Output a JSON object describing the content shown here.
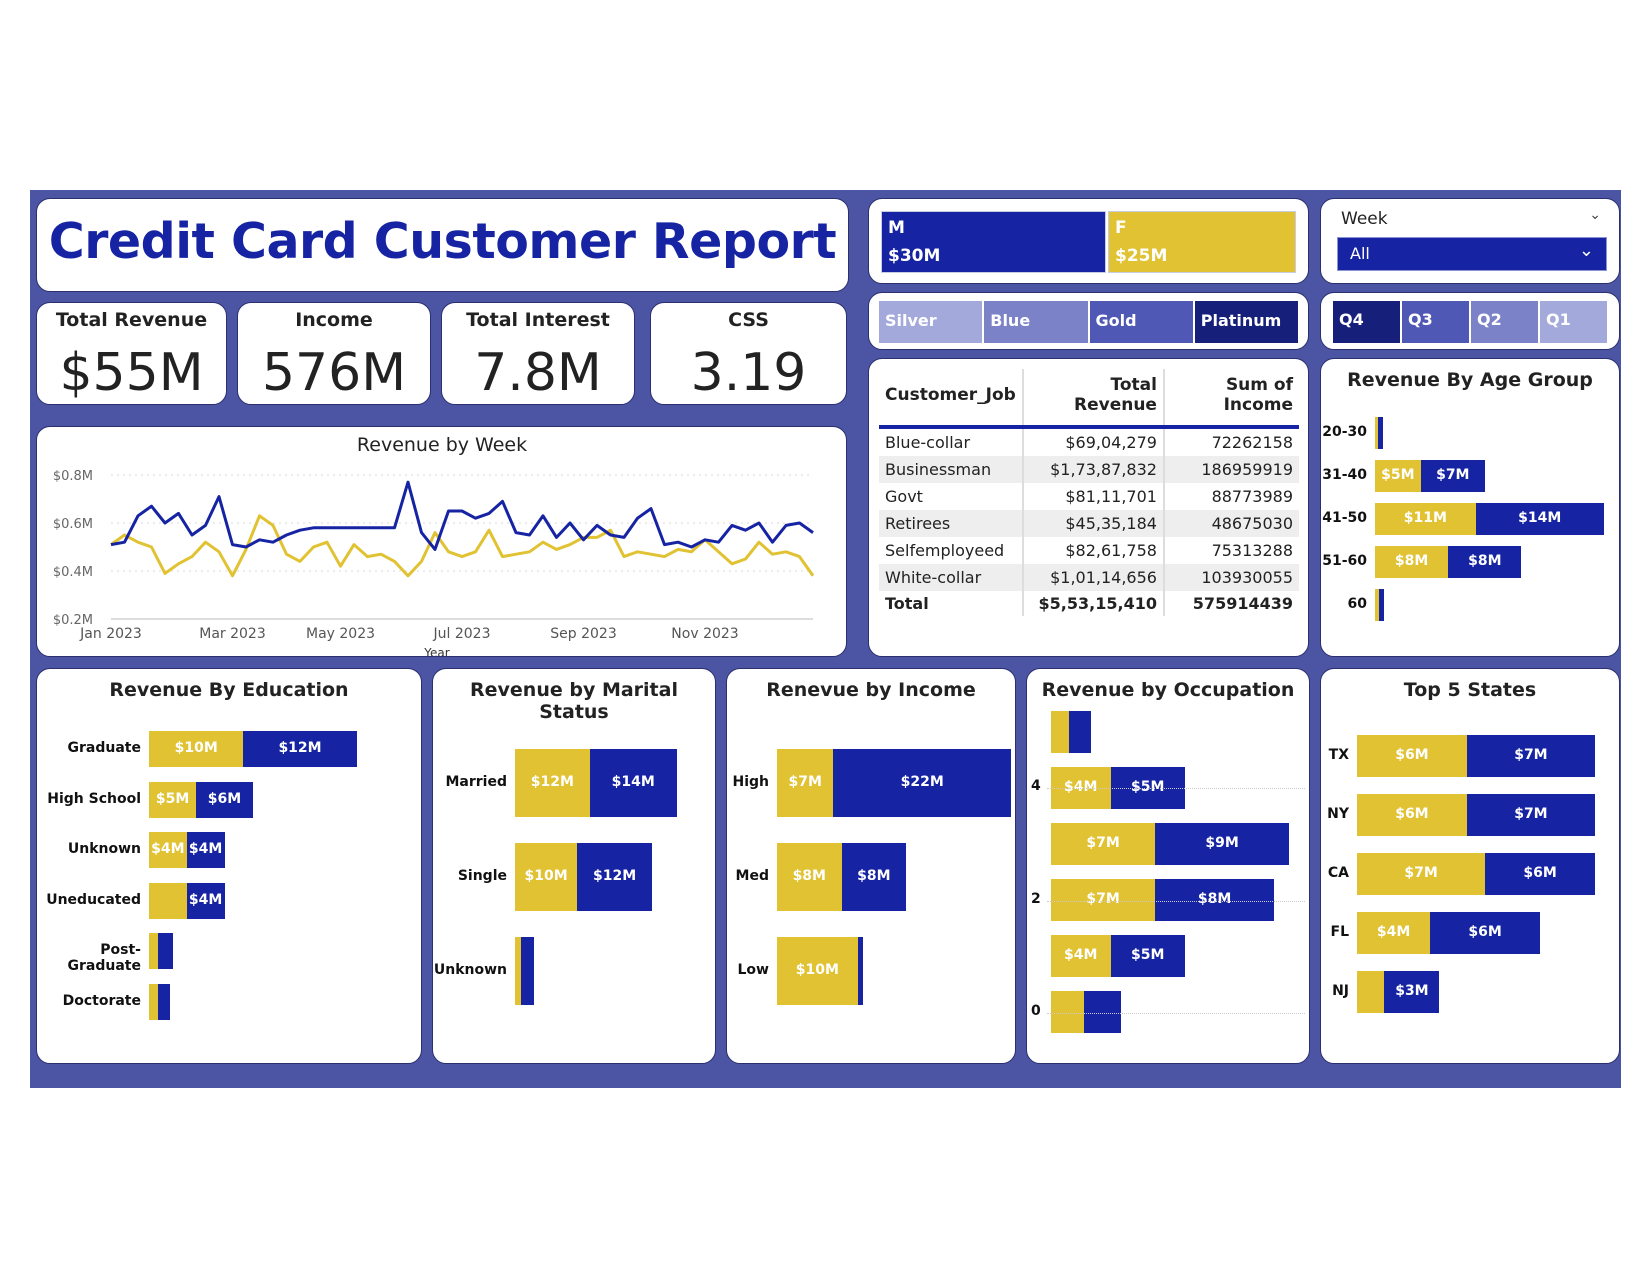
{
  "title": "Credit Card Customer Report",
  "colors": {
    "navy": "#1624a3",
    "gold": "#e0c232",
    "frame": "#4b55a3"
  },
  "kpis": [
    {
      "label": "Total Revenue",
      "value": "$55M"
    },
    {
      "label": "Income",
      "value": "576M"
    },
    {
      "label": "Total Interest",
      "value": "7.8M"
    },
    {
      "label": "CSS",
      "value": "3.19"
    }
  ],
  "gender": [
    {
      "label": "M",
      "value": "$30M",
      "share": 0.545
    },
    {
      "label": "F",
      "value": "$25M",
      "share": 0.455
    }
  ],
  "card_category": [
    "Silver",
    "Blue",
    "Gold",
    "Platinum"
  ],
  "week_slicer": {
    "label": "Week",
    "selected": "All"
  },
  "quarters": [
    "Q4",
    "Q3",
    "Q2",
    "Q1"
  ],
  "job_table": {
    "headers": [
      "Customer_Job",
      "Total Revenue",
      "Sum of Income"
    ],
    "rows": [
      [
        "Blue-collar",
        "$69,04,279",
        "72262158"
      ],
      [
        "Businessman",
        "$1,73,87,832",
        "186959919"
      ],
      [
        "Govt",
        "$81,11,701",
        "88773989"
      ],
      [
        "Retirees",
        "$45,35,184",
        "48675030"
      ],
      [
        "Selfemployeed",
        "$82,61,758",
        "75313288"
      ],
      [
        "White-collar",
        "$1,01,14,656",
        "103930055"
      ]
    ],
    "total": [
      "Total",
      "$5,53,15,410",
      "575914439"
    ]
  },
  "panels": {
    "week": "Revenue by Week",
    "age": "Revenue By Age Group",
    "education": "Revenue By Education",
    "marital": "Revenue by Marital Status",
    "income": "Renevue by Income",
    "occupation": "Revenue by Occupation",
    "states": "Top 5 States"
  },
  "chart_data": [
    {
      "type": "line",
      "title": "Revenue by Week",
      "xlabel": "Year",
      "ylabel": "",
      "x_ticks": [
        "Jan 2023",
        "Mar 2023",
        "May 2023",
        "Jul 2023",
        "Sep 2023",
        "Nov 2023"
      ],
      "y_ticks": [
        "$0.2M",
        "$0.4M",
        "$0.6M",
        "$0.8M"
      ],
      "ylim": [
        0.2,
        0.8
      ],
      "grid": true,
      "series": [
        {
          "color": "#1624a3",
          "values": [
            0.51,
            0.52,
            0.63,
            0.67,
            0.6,
            0.64,
            0.55,
            0.59,
            0.71,
            0.51,
            0.5,
            0.53,
            0.52,
            0.55,
            0.57,
            0.58,
            0.58,
            0.58,
            0.58,
            0.58,
            0.58,
            0.58,
            0.77,
            0.56,
            0.49,
            0.65,
            0.65,
            0.62,
            0.64,
            0.69,
            0.56,
            0.55,
            0.63,
            0.54,
            0.6,
            0.53,
            0.59,
            0.55,
            0.54,
            0.62,
            0.66,
            0.51,
            0.52,
            0.5,
            0.53,
            0.52,
            0.59,
            0.57,
            0.6,
            0.52,
            0.59,
            0.6,
            0.56
          ]
        },
        {
          "color": "#e0c232",
          "values": [
            0.51,
            0.55,
            0.52,
            0.5,
            0.39,
            0.43,
            0.46,
            0.52,
            0.48,
            0.38,
            0.49,
            0.63,
            0.59,
            0.47,
            0.44,
            0.5,
            0.52,
            0.42,
            0.51,
            0.46,
            0.47,
            0.44,
            0.38,
            0.44,
            0.56,
            0.48,
            0.46,
            0.48,
            0.57,
            0.46,
            0.47,
            0.48,
            0.52,
            0.49,
            0.51,
            0.54,
            0.54,
            0.57,
            0.46,
            0.48,
            0.47,
            0.46,
            0.49,
            0.48,
            0.53,
            0.48,
            0.43,
            0.45,
            0.52,
            0.47,
            0.48,
            0.46,
            0.38
          ]
        }
      ]
    },
    {
      "type": "bar",
      "title": "Revenue By Age Group",
      "categories": [
        "20-30",
        "31-40",
        "41-50",
        "51-60",
        "60"
      ],
      "series": [
        {
          "color": "#e0c232",
          "values": [
            0.3,
            5,
            11,
            8,
            0.4
          ],
          "labels": [
            "",
            "$5M",
            "$11M",
            "$8M",
            ""
          ]
        },
        {
          "color": "#1624a3",
          "values": [
            0.6,
            7,
            14,
            8,
            0.6
          ],
          "labels": [
            "",
            "$7M",
            "$14M",
            "$8M",
            ""
          ]
        }
      ],
      "max": 26
    },
    {
      "type": "bar",
      "title": "Revenue By Education",
      "categories": [
        "Graduate",
        "High School",
        "Unknown",
        "Uneducated",
        "Post-Graduate",
        "Doctorate"
      ],
      "series": [
        {
          "color": "#e0c232",
          "values": [
            10,
            5,
            4,
            4,
            1,
            1
          ],
          "labels": [
            "$10M",
            "$5M",
            "$4M",
            "",
            "",
            ""
          ]
        },
        {
          "color": "#1624a3",
          "values": [
            12,
            6,
            4,
            4,
            1.5,
            1.2
          ],
          "labels": [
            "$12M",
            "$6M",
            "$4M",
            "$4M",
            "",
            ""
          ]
        }
      ],
      "max": 25
    },
    {
      "type": "bar",
      "title": "Revenue by Marital Status",
      "categories": [
        "Married",
        "Single",
        "Unknown"
      ],
      "series": [
        {
          "color": "#e0c232",
          "values": [
            12,
            10,
            1
          ],
          "labels": [
            "$12M",
            "$10M",
            ""
          ]
        },
        {
          "color": "#1624a3",
          "values": [
            14,
            12,
            2
          ],
          "labels": [
            "$14M",
            "$12M",
            ""
          ]
        }
      ],
      "max": 27
    },
    {
      "type": "bar",
      "title": "Renevue by Income",
      "categories": [
        "High",
        "Med",
        "Low"
      ],
      "series": [
        {
          "color": "#e0c232",
          "values": [
            7,
            8,
            10
          ],
          "labels": [
            "$7M",
            "$8M",
            "$10M"
          ]
        },
        {
          "color": "#1624a3",
          "values": [
            22,
            8,
            0.6
          ],
          "labels": [
            "$22M",
            "$8M",
            ""
          ]
        }
      ],
      "max": 29
    },
    {
      "type": "bar",
      "title": "Revenue by Occupation",
      "categories": [
        "",
        "",
        "",
        "",
        "",
        ""
      ],
      "y_ticks": [
        "4",
        "2",
        "0"
      ],
      "series": [
        {
          "color": "#e0c232",
          "values": [
            1.2,
            4,
            7,
            7,
            4,
            2.2
          ],
          "labels": [
            "",
            "$4M",
            "$7M",
            "$7M",
            "$4M",
            ""
          ]
        },
        {
          "color": "#1624a3",
          "values": [
            1.5,
            5,
            9,
            8,
            5,
            2.5
          ],
          "labels": [
            "",
            "$5M",
            "$9M",
            "$8M",
            "$5M",
            ""
          ]
        }
      ],
      "max": 16
    },
    {
      "type": "bar",
      "title": "Top 5 States",
      "categories": [
        "TX",
        "NY",
        "CA",
        "FL",
        "NJ"
      ],
      "series": [
        {
          "color": "#e0c232",
          "values": [
            6,
            6,
            7,
            4,
            1.5
          ],
          "labels": [
            "$6M",
            "$6M",
            "$7M",
            "$4M",
            ""
          ]
        },
        {
          "color": "#1624a3",
          "values": [
            7,
            7,
            6,
            6,
            3
          ],
          "labels": [
            "$7M",
            "$7M",
            "$6M",
            "$6M",
            "$3M"
          ]
        }
      ],
      "max": 13
    }
  ]
}
